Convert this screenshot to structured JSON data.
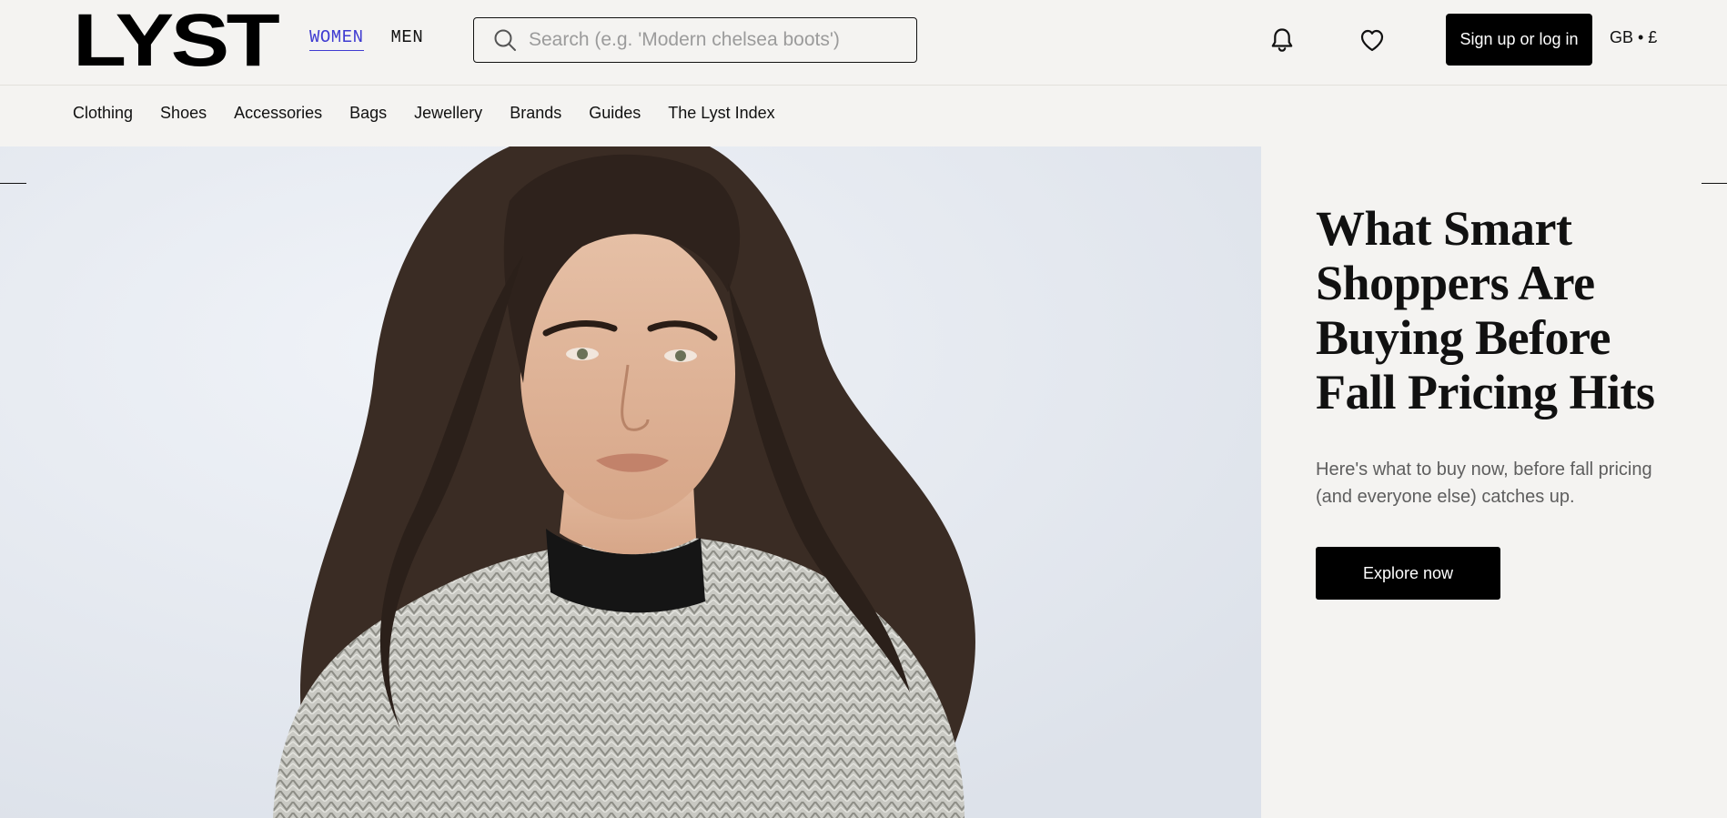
{
  "header": {
    "logo": "LYST",
    "gender_tabs": [
      {
        "label": "WOMEN",
        "active": true
      },
      {
        "label": "MEN",
        "active": false
      }
    ],
    "search": {
      "placeholder": "Search (e.g. 'Modern chelsea boots')",
      "value": ""
    },
    "icons": [
      "bell-icon",
      "heart-icon",
      "search-icon"
    ],
    "signup_label": "Sign up or log in",
    "region_label": "GB • £"
  },
  "category_nav": {
    "items": [
      "Clothing",
      "Shoes",
      "Accessories",
      "Bags",
      "Jewellery",
      "Brands",
      "Guides",
      "The Lyst Index"
    ]
  },
  "hero": {
    "title": "What Smart Shoppers Are Buying Before Fall Pricing Hits",
    "subtitle": "Here's what to buy now, before fall pricing (and everyone else) catches up.",
    "cta_label": "Explore now"
  },
  "colors": {
    "page_bg": "#f4f3f1",
    "accent_active": "#3f3bd1",
    "button_bg": "#000000",
    "button_text": "#ffffff",
    "hero_bg": "#e5e9f1"
  }
}
